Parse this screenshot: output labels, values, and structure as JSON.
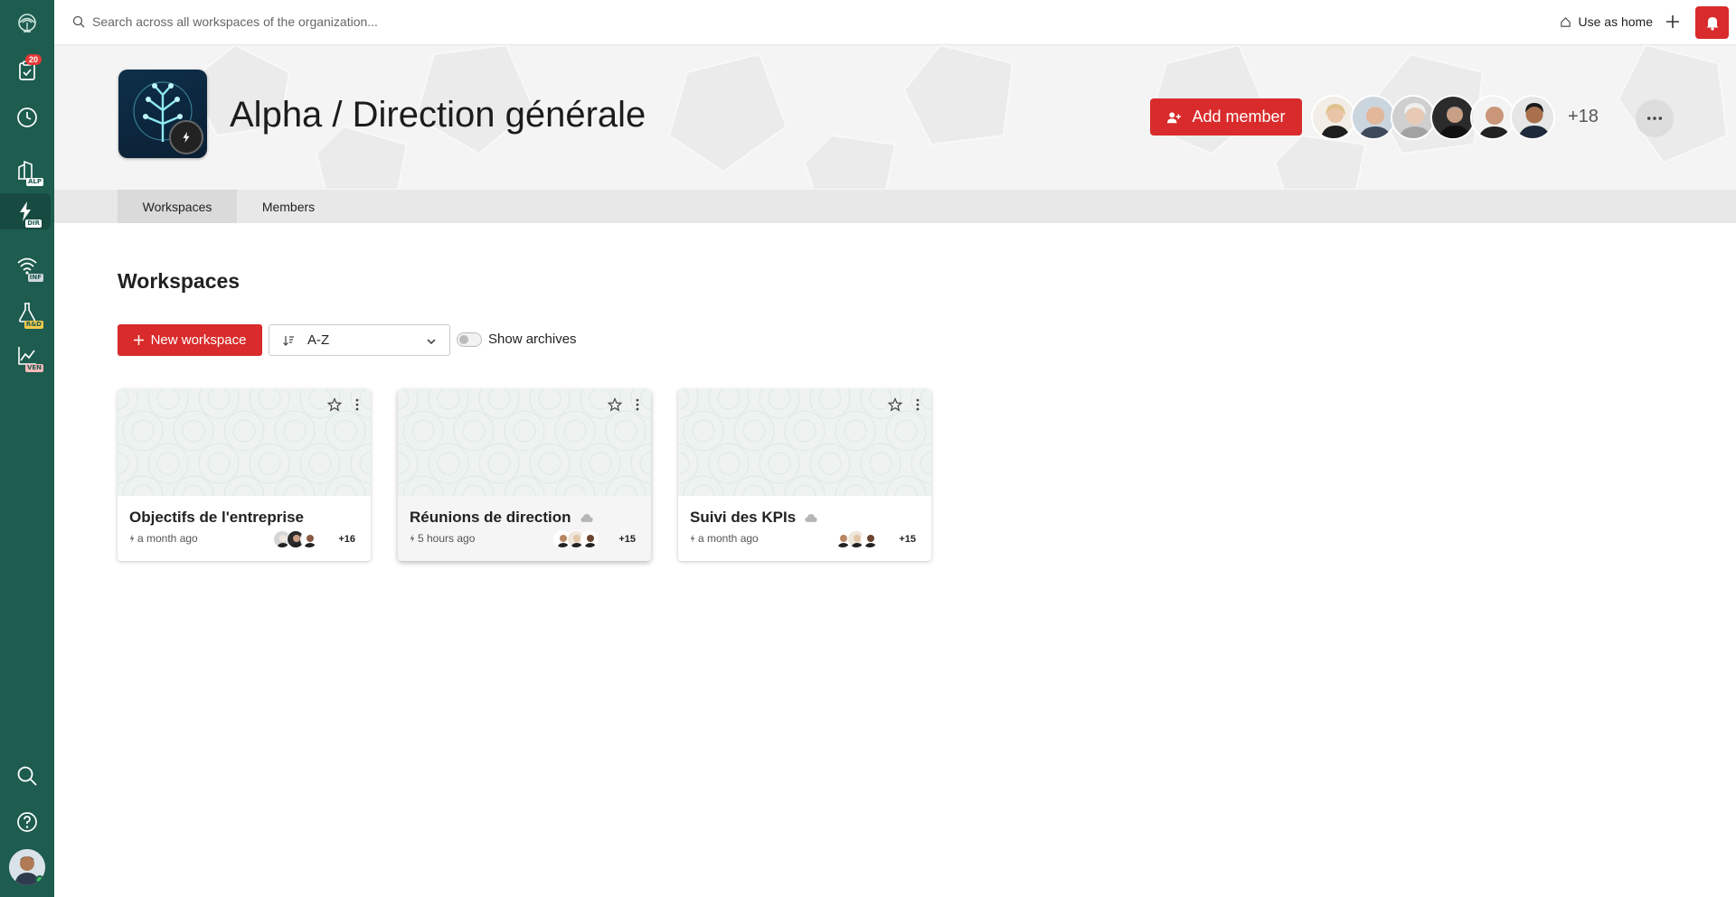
{
  "topbar": {
    "search_placeholder": "Search across all workspaces of the organization...",
    "use_as_home": "Use as home"
  },
  "rail": {
    "notifications_count": "20",
    "spaces": [
      {
        "tag": "ALP",
        "icon": "buildings-icon"
      },
      {
        "tag": "DIR",
        "icon": "bolt-icon"
      },
      {
        "tag": "INF",
        "icon": "wifi-icon"
      },
      {
        "tag": "R&D",
        "icon": "flask-icon"
      },
      {
        "tag": "VEN",
        "icon": "chart-line-icon"
      }
    ]
  },
  "header": {
    "title": "Alpha / Direction générale",
    "add_member_label": "Add member",
    "members_more": "+18"
  },
  "tabs": [
    {
      "label": "Workspaces",
      "active": true
    },
    {
      "label": "Members",
      "active": false
    }
  ],
  "main": {
    "section_title": "Workspaces",
    "new_workspace_label": "New workspace",
    "sort_value": "A-Z",
    "show_archives_label": "Show archives",
    "show_archives_on": false
  },
  "workspaces": [
    {
      "name": "Objectifs de l'entreprise",
      "time": "a month ago",
      "members_more": "+16",
      "cloud": false
    },
    {
      "name": "Réunions de direction",
      "time": "5 hours ago",
      "members_more": "+15",
      "cloud": true
    },
    {
      "name": "Suivi des KPIs",
      "time": "a month ago",
      "members_more": "+15",
      "cloud": true
    }
  ],
  "colors": {
    "rail_bg": "#1d5c4f",
    "accent_red": "#d92b2b"
  }
}
